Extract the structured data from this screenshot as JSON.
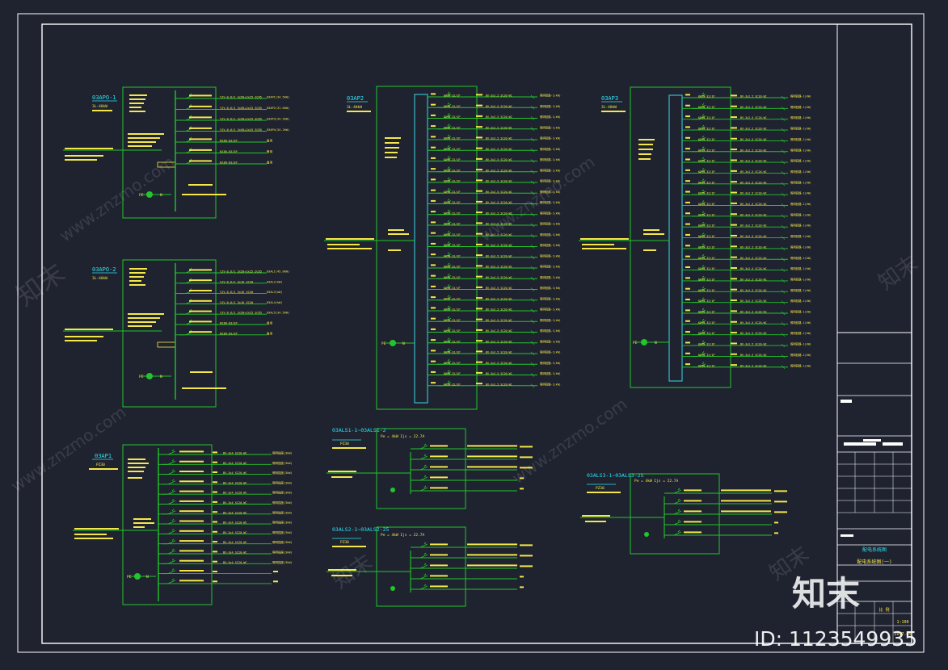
{
  "drawing": {
    "colors": {
      "background": "#1f2330",
      "frame": "#ffffff",
      "panel": "#22c52a",
      "text_yellow": "#f5e74a",
      "text_cyan": "#2ee0f0",
      "busbar": "#38c8d8"
    }
  },
  "panels": {
    "p1": {
      "name": "03APO-1",
      "sub": "3L-40kW",
      "feeders": [
        "YJV-0.6/1 3x50+2x25 SC65",
        "YJV-0.6/1 3x50+2x25 SC65",
        "YJV-0.6/1 3x50+2x25 SC65",
        "YJV-0.6/1 3x50+2x25 SC65",
        "KX3N-63/3P",
        "KX3N-63/3P",
        "KX3N-63/3P"
      ],
      "loads": [
        "03AP1(34.5kW)",
        "03AP2(31.6kW)",
        "03AP3(34.5kW)",
        "03AP4(34.2kW)",
        "备用",
        "备用",
        "备用"
      ]
    },
    "p2": {
      "name": "03APO-2",
      "sub": "3L-40kW",
      "feeders": [
        "YJV-0.6/1 3x50+2x25 SC65",
        "YJV-0.6/1 3x16 SC40",
        "YJV-0.6/1 3x16 SC40",
        "YJV-0.6/1 3x16 SC40",
        "YJV-0.6/1 3x50+2x25 SC65",
        "KX3N-63/3P",
        "KX3N-63/3P"
      ],
      "loads": [
        "03AL1(45.8kW)",
        "03AL2(kW)",
        "03AL3(kW)",
        "03AL4(kW)",
        "03AL5(34.5kW)",
        "备用",
        "备用"
      ]
    },
    "apl": {
      "name": "03AP1",
      "sub": "PZ30",
      "feeder": "BV-3x4 SC20-WC",
      "load": "照明插座(3kW)"
    },
    "ap2": {
      "name": "03AP2",
      "sub": "3L-40kW",
      "breaker": "KX3N-32/1P",
      "feeder": "BV-3x2.5 SC20-WC",
      "load": "照明回路-1(kW)"
    },
    "ap3": {
      "name": "03AP3",
      "sub": "3L-40kW",
      "breaker": "KX3N-32/1P",
      "feeder": "BV-3x2.5 SC20-WC",
      "load": "照明回路-1(kW)"
    },
    "als1": {
      "name": "03ALS1-1~03ALS1-2",
      "sub": "PZ30",
      "head": "Pe = 4kW   Ijs = 22.7A"
    },
    "als2": {
      "name": "03ALS2-1~03ALS2-25",
      "sub": "PZ30",
      "head": "Pe = 4kW   Ijs = 22.7A"
    },
    "als3": {
      "name": "03ALS3-1~03ALS3-25",
      "sub": "PZ30",
      "head": "Pe = 4kW   Ijs = 22.7A"
    }
  },
  "title_block": {
    "project": "配电系统图",
    "drawing_name": "配电系统图(一)",
    "scale_label": "比 例",
    "scale": "1:100",
    "date": "2017.05"
  },
  "watermark": {
    "brand": "知末",
    "site": "www.znzmo.com",
    "id_label": "ID: 1123549935"
  }
}
